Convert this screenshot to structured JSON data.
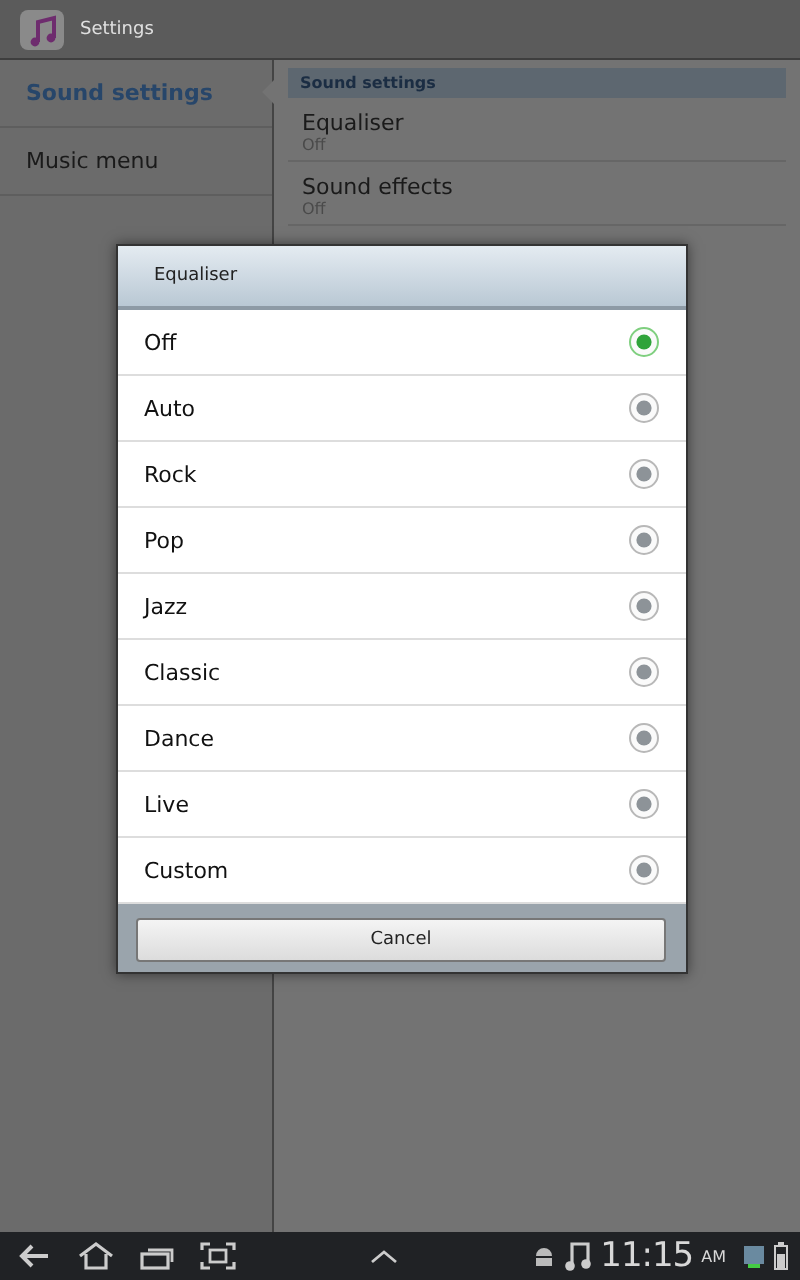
{
  "header": {
    "title": "Settings"
  },
  "sidebar": {
    "items": [
      {
        "label": "Sound settings",
        "selected": true
      },
      {
        "label": "Music menu",
        "selected": false
      }
    ]
  },
  "content": {
    "section": "Sound settings",
    "items": [
      {
        "title": "Equaliser",
        "value": "Off"
      },
      {
        "title": "Sound effects",
        "value": "Off"
      }
    ]
  },
  "dialog": {
    "title": "Equaliser",
    "options": [
      {
        "label": "Off",
        "selected": true
      },
      {
        "label": "Auto",
        "selected": false
      },
      {
        "label": "Rock",
        "selected": false
      },
      {
        "label": "Pop",
        "selected": false
      },
      {
        "label": "Jazz",
        "selected": false
      },
      {
        "label": "Classic",
        "selected": false
      },
      {
        "label": "Dance",
        "selected": false
      },
      {
        "label": "Live",
        "selected": false
      },
      {
        "label": "Custom",
        "selected": false
      }
    ],
    "cancel": "Cancel"
  },
  "status_bar": {
    "time": "11:15",
    "ampm": "AM"
  }
}
